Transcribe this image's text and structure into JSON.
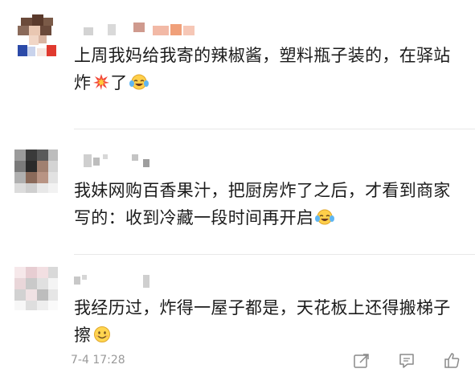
{
  "comments": [
    {
      "text": "上周我妈给我寄的辣椒酱，塑料瓶子装的，在驿站炸",
      "text_tail": "了"
    },
    {
      "text": "我妹网购百香果汁，把厨房炸了之后，才看到商家写的：收到冷藏一段时间再开启"
    },
    {
      "text": "我经历过，炸得一屋子都是，天花板上还得搬梯子擦"
    }
  ],
  "footer": {
    "timestamp": "7-4 17:28"
  },
  "icons": [
    "explosion-emoji",
    "laughing-tears-emoji",
    "smile-emoji",
    "share-icon",
    "comment-icon",
    "like-icon"
  ],
  "colors": {
    "text": "#1b1b1b",
    "meta": "#9a9a9a",
    "divider": "#e8e8e8"
  }
}
